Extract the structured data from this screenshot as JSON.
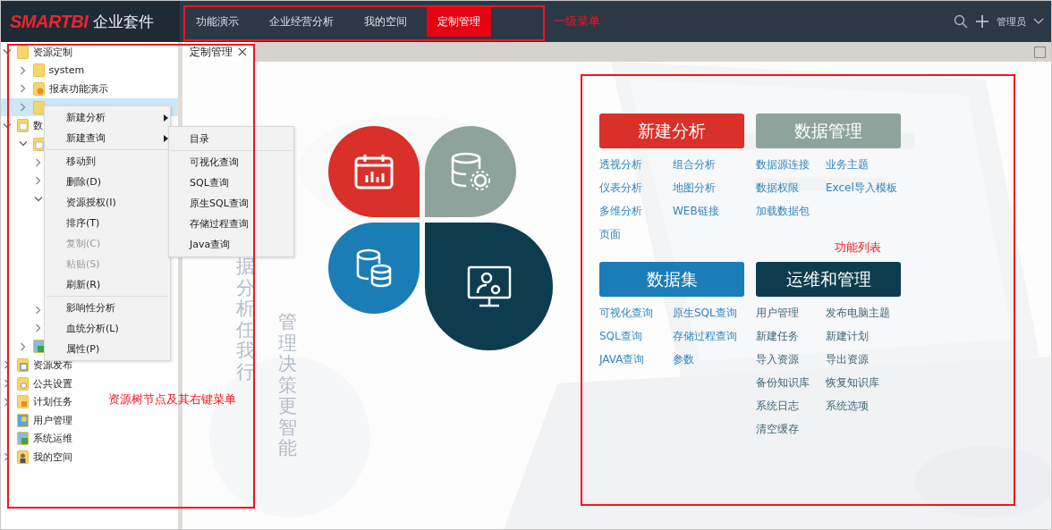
{
  "header": {
    "logo": "SMARTBI",
    "product": "企业套件",
    "nav": [
      {
        "label": "功能演示",
        "selected": false
      },
      {
        "label": "企业经营分析",
        "selected": false
      },
      {
        "label": "我的空间",
        "selected": false
      },
      {
        "label": "定制管理",
        "selected": true
      }
    ],
    "user": "管理员"
  },
  "tree": [
    {
      "label": "资源定制",
      "kind": "folder",
      "expanded": true,
      "selected": false,
      "children": [
        {
          "label": "system",
          "kind": "folder",
          "expanded": false,
          "selected": false
        },
        {
          "label": "报表功能演示",
          "kind": "report-folder",
          "expanded": false,
          "selected": false
        },
        {
          "kind": "folder",
          "expanded": false,
          "selected": true
        }
      ]
    },
    {
      "label": "数",
      "kind": "doc-folder",
      "expanded": true,
      "selected": false,
      "children": [
        {
          "kind": "doc-folder",
          "expanded": true,
          "selected": false,
          "children": [
            {
              "expanded": false,
              "selected": false
            },
            {
              "expanded": false,
              "selected": false
            },
            {
              "expanded": true,
              "selected": false
            },
            {
              "expanded": false,
              "selected": false
            },
            {
              "expanded": false,
              "selected": false
            }
          ]
        },
        {
          "kind": "system",
          "expanded": false,
          "selected": false
        }
      ]
    },
    {
      "label": "资源发布",
      "kind": "publish",
      "expanded": false,
      "selected": false
    },
    {
      "label": "公共设置",
      "kind": "settings",
      "expanded": false,
      "selected": false
    },
    {
      "label": "计划任务",
      "kind": "schedule",
      "expanded": false,
      "selected": false
    },
    {
      "label": "用户管理",
      "kind": "users",
      "selected": false
    },
    {
      "label": "系统运维",
      "kind": "system",
      "selected": false
    },
    {
      "label": "我的空间",
      "kind": "space",
      "expanded": false,
      "selected": false
    }
  ],
  "context_menu": [
    {
      "kind": "submenu",
      "label": "新建分析",
      "disabled": false
    },
    {
      "kind": "submenu",
      "label": "新建查询",
      "disabled": false
    },
    {
      "kind": "separator"
    },
    {
      "kind": "item",
      "label": "移动到",
      "disabled": false
    },
    {
      "kind": "item",
      "label": "删除(D)",
      "disabled": false
    },
    {
      "kind": "item",
      "label": "资源授权(I)",
      "disabled": false
    },
    {
      "kind": "item",
      "label": "排序(T)",
      "disabled": false
    },
    {
      "kind": "item",
      "label": "复制(C)",
      "disabled": true
    },
    {
      "kind": "item",
      "label": "粘贴(S)",
      "disabled": true
    },
    {
      "kind": "item",
      "label": "刷新(R)",
      "disabled": false
    },
    {
      "kind": "separator"
    },
    {
      "kind": "item",
      "label": "影响性分析",
      "disabled": false
    },
    {
      "kind": "item",
      "label": "血统分析(L)",
      "disabled": false
    },
    {
      "kind": "item",
      "label": "属性(P)",
      "disabled": false
    }
  ],
  "submenu": [
    {
      "kind": "item",
      "label": "目录"
    },
    {
      "kind": "separator"
    },
    {
      "kind": "item",
      "label": "可视化查询"
    },
    {
      "kind": "item",
      "label": "SQL查询"
    },
    {
      "kind": "item",
      "label": "原生SQL查询"
    },
    {
      "kind": "item",
      "label": "存储过程查询"
    },
    {
      "kind": "item",
      "label": "Java查询"
    }
  ],
  "tabs": [
    {
      "label": "定制管理",
      "selected": true
    }
  ],
  "slogans": [
    "据分析任我行",
    "管理决策更智能"
  ],
  "flower": [
    {
      "kind": "calendar",
      "color": "#d9302a"
    },
    {
      "kind": "database-gear",
      "color": "#8fa39d"
    },
    {
      "kind": "database",
      "color": "#1b7db5"
    },
    {
      "kind": "monitor",
      "color": "#0e3c4f"
    }
  ],
  "function_groups": [
    {
      "title": "新建分析",
      "color": "#d9302a",
      "links": [
        "透视分析",
        "组合分析",
        "仪表分析",
        "地图分析",
        "多维分析",
        "WEB链接",
        "页面"
      ]
    },
    {
      "title": "数据管理",
      "color": "#8fa39d",
      "links": [
        "数据源连接",
        "业务主题",
        "数据权限",
        "Excel导入模板",
        "加载数据包"
      ]
    },
    {
      "title": "数据集",
      "color": "#1b7db5",
      "links": [
        "可视化查询",
        "原生SQL查询",
        "SQL查询",
        "存储过程查询",
        "JAVA查询",
        "参数"
      ]
    },
    {
      "title": "运维和管理",
      "color": "#0e3c4f",
      "links": [
        "用户管理",
        "发布电脑主题",
        "新建任务",
        "新建计划",
        "导入资源",
        "导出资源",
        "备份知识库",
        "恢复知识库",
        "系统日志",
        "系统选项",
        "清空缓存"
      ]
    }
  ],
  "annotations": [
    {
      "label": "一级菜单"
    },
    {
      "label": "资源树节点及其右键菜单"
    },
    {
      "label": "功能列表"
    }
  ]
}
